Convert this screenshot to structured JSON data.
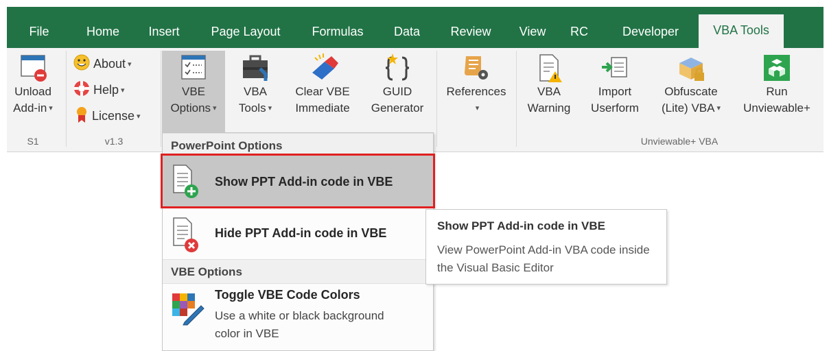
{
  "tabs": [
    "File",
    "Home",
    "Insert",
    "Page Layout",
    "Formulas",
    "Data",
    "Review",
    "View",
    "RC",
    "Developer",
    "VBA Tools"
  ],
  "active_tab": "VBA Tools",
  "colors": {
    "accent": "#217346",
    "ribbon_bg": "#f3f3f3",
    "highlight_border": "#e02020"
  },
  "ribbon": {
    "unload": {
      "line1": "Unload",
      "line2": "Add-in"
    },
    "about": "About",
    "help": "Help",
    "license": "License",
    "vbe_options": {
      "line1": "VBE",
      "line2": "Options"
    },
    "vba_tools": {
      "line1": "VBA",
      "line2": "Tools"
    },
    "clear_vbe": {
      "line1": "Clear VBE",
      "line2": "Immediate"
    },
    "guid": {
      "line1": "GUID",
      "line2": "Generator"
    },
    "references": {
      "line1": "References"
    },
    "vba_warning": {
      "line1": "VBA",
      "line2": "Warning"
    },
    "import_userform": {
      "line1": "Import",
      "line2": "Userform"
    },
    "obfuscate": {
      "line1": "Obfuscate",
      "line2": "(Lite) VBA"
    },
    "run_unviewable": {
      "line1": "Run",
      "line2": "Unviewable+"
    },
    "groups": {
      "s1": "S1",
      "v13": "v1.3",
      "unviewable": "Unviewable+ VBA"
    }
  },
  "menu": {
    "ppt_header": "PowerPoint Options",
    "show_ppt": "Show PPT Add-in code in VBE",
    "hide_ppt": "Hide PPT Add-in code in VBE",
    "vbe_header": "VBE Options",
    "toggle_colors": {
      "title": "Toggle VBE Code Colors",
      "desc": "Use a white or black background color in VBE"
    }
  },
  "tooltip": {
    "title": "Show PPT Add-in code in VBE",
    "body": "View PowerPoint Add-in VBA code inside the Visual Basic Editor"
  }
}
